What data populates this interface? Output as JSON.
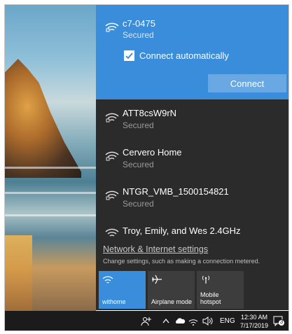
{
  "networks": {
    "selected": {
      "name": "c7-0475",
      "status": "Secured",
      "connect_auto_label": "Connect automatically",
      "connect_auto_checked": true,
      "connect_label": "Connect"
    },
    "items": [
      {
        "name": "ATT8csW9rN",
        "status": "Secured"
      },
      {
        "name": "Cervero Home",
        "status": "Secured"
      },
      {
        "name": "NTGR_VMB_1500154821",
        "status": "Secured"
      },
      {
        "name": "Troy, Emily, and Wes 2.4GHz",
        "status": ""
      }
    ]
  },
  "settings": {
    "link_label": "Network & Internet settings",
    "description": "Change settings, such as making a connection metered."
  },
  "tiles": [
    {
      "label": "withome",
      "icon": "wifi-icon",
      "active": true
    },
    {
      "label": "Airplane mode",
      "icon": "airplane-icon",
      "active": false
    },
    {
      "label": "Mobile hotspot",
      "label_line1": "Mobile",
      "label_line2": "hotspot",
      "icon": "hotspot-icon",
      "active": false
    }
  ],
  "taskbar": {
    "language": "ENG",
    "time": "12:30 AM",
    "date": "7/17/2019",
    "notification_count": "3"
  },
  "colors": {
    "accent": "#3a8ddb",
    "flyout_bg": "#2b2b2b",
    "tile_bg": "#3d3d3d",
    "taskbar_bg": "#1b1b1b"
  }
}
